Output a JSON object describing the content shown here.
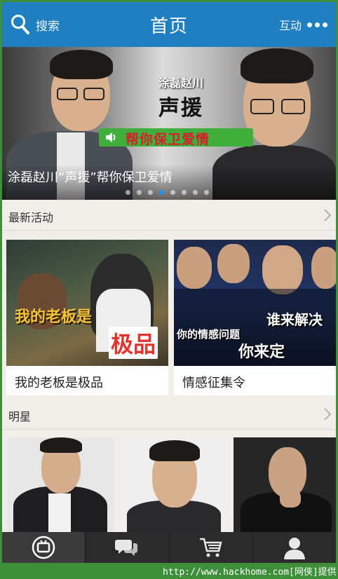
{
  "header": {
    "search_label": "搜索",
    "title": "首页",
    "interact_label": "互动"
  },
  "banner": {
    "brand_small": "涂磊赵川",
    "brand_big": "声援",
    "strip_text": "帮你保卫爱情",
    "caption": "涂磊赵川“声援”帮你保卫爱情",
    "page_count": 8,
    "active_page": 4
  },
  "activities": {
    "title": "最新活动",
    "items": [
      {
        "label": "我的老板是极品",
        "art_line1": "我的老板是",
        "art_line2": "极品"
      },
      {
        "label": "情感征集令",
        "art_line1": "你的情感问题",
        "art_line2": "谁来解决",
        "art_line3": "你来定"
      }
    ]
  },
  "stars": {
    "title": "明星"
  },
  "tabbar": {
    "tabs": [
      {
        "icon": "tv-icon",
        "active": true
      },
      {
        "icon": "chat-icon",
        "active": false
      },
      {
        "icon": "cart-icon",
        "active": false
      },
      {
        "icon": "user-icon",
        "active": false
      }
    ]
  },
  "footer": {
    "watermark": "http://www.hackhome.com[网侠]提供"
  },
  "colors": {
    "header": "#1f7fc0",
    "tabbar": "#2b2b2b",
    "background": "#f1eeea",
    "frame": "#3d8f3a"
  }
}
